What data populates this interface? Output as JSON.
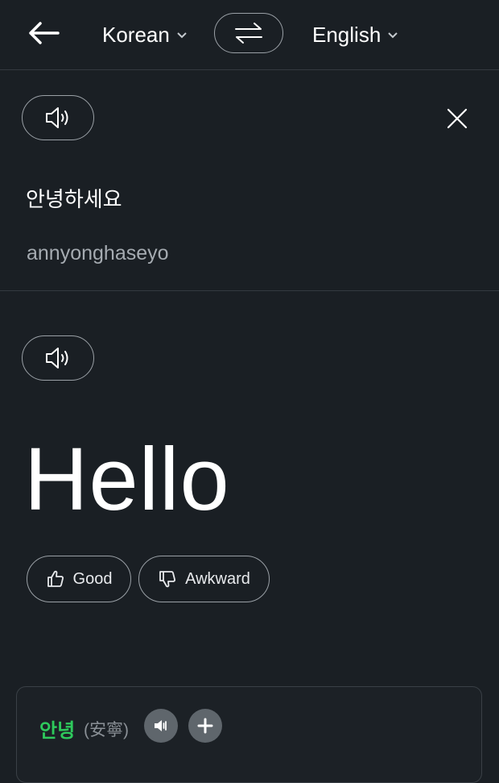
{
  "header": {
    "source_lang": "Korean",
    "target_lang": "English"
  },
  "source": {
    "text": "안녕하세요",
    "romanization": "annyonghaseyo"
  },
  "translation": {
    "text": "Hello",
    "good_label": "Good",
    "awkward_label": "Awkward"
  },
  "dictionary": {
    "word": "안녕",
    "hanja": "(安寧)"
  },
  "icons": {
    "back": "arrow-left-icon",
    "chevron": "chevron-down-icon",
    "swap": "swap-arrows-icon",
    "speaker": "speaker-icon",
    "close": "close-icon",
    "thumbs_up": "thumbs-up-icon",
    "thumbs_down": "thumbs-down-icon",
    "plus": "plus-icon"
  },
  "colors": {
    "background": "#1a1f24",
    "accent_green": "#2ec95c",
    "text_secondary": "#a5abb1"
  }
}
